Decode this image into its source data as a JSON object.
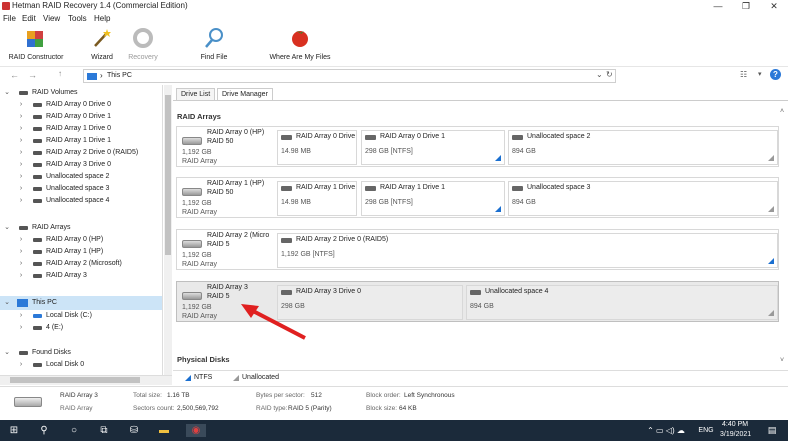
{
  "window": {
    "title": "Hetman RAID Recovery 1.4 (Commercial Edition)",
    "minimize": "—",
    "maximize": "❐",
    "close": "✕"
  },
  "menu": [
    "File",
    "Edit",
    "View",
    "Tools",
    "Help"
  ],
  "ribbon": {
    "raid_constructor": "RAID Constructor",
    "wizard": "Wizard",
    "recovery": "Recovery",
    "find_file": "Find File",
    "where_are_my_files": "Where Are My Files"
  },
  "address": {
    "back": "←",
    "forward": "→",
    "up": "↑",
    "path": "This PC",
    "sep": "›",
    "dropdown": "⌄",
    "refresh": "↻"
  },
  "tree": {
    "raid_volumes": "RAID Volumes",
    "volumes": [
      "RAID Array 0 Drive 0",
      "RAID Array 0 Drive 1",
      "RAID Array 1 Drive 0",
      "RAID Array 1 Drive 1",
      "RAID Array 2 Drive 0 (RAID5)",
      "RAID Array 3 Drive 0",
      "Unallocated space 2",
      "Unallocated space 3",
      "Unallocated space 4"
    ],
    "raid_arrays": "RAID Arrays",
    "arrays": [
      "RAID Array 0 (HP)",
      "RAID Array 1 (HP)",
      "RAID Array 2 (Microsoft)",
      "RAID Array 3"
    ],
    "this_pc": "This PC",
    "pc_items": [
      "Local Disk (C:)",
      "4 (E:)"
    ],
    "found_disks": "Found Disks",
    "found_items": [
      "Local Disk 0"
    ]
  },
  "tabs": {
    "drive_list": "Drive List",
    "drive_manager": "Drive Manager"
  },
  "sections": {
    "raid_arrays": "RAID Arrays",
    "physical_disks": "Physical Disks"
  },
  "rows": [
    {
      "name1": "RAID Array 0 (HP)",
      "name2": "RAID 50",
      "size": "1,192 GB",
      "type": "RAID Array",
      "parts": [
        {
          "name": "RAID Array 0 Drive",
          "sub": "14.98 MB"
        },
        {
          "name": "RAID Array 0 Drive 1",
          "sub": "298 GB [NTFS]"
        },
        {
          "name": "Unallocated space 2",
          "sub": "894 GB"
        }
      ]
    },
    {
      "name1": "RAID Array 1 (HP)",
      "name2": "RAID 50",
      "size": "1,192 GB",
      "type": "RAID Array",
      "parts": [
        {
          "name": "RAID Array 1 Drive",
          "sub": "14.98 MB"
        },
        {
          "name": "RAID Array 1 Drive 1",
          "sub": "298 GB [NTFS]"
        },
        {
          "name": "Unallocated space 3",
          "sub": "894 GB"
        }
      ]
    },
    {
      "name1": "RAID Array 2 (Micro",
      "name2": "RAID 5",
      "size": "1,192 GB",
      "type": "RAID Array",
      "parts": [
        {
          "name": "RAID Array 2 Drive 0 (RAID5)",
          "sub": "1,192 GB [NTFS]"
        }
      ]
    },
    {
      "name1": "RAID Array 3",
      "name2": "RAID 5",
      "size": "1,192 GB",
      "type": "RAID Array",
      "parts": [
        {
          "name": "RAID Array 3 Drive 0",
          "sub": "298 GB"
        },
        {
          "name": "Unallocated space 4",
          "sub": "894 GB"
        }
      ]
    }
  ],
  "legend": {
    "ntfs": "NTFS",
    "unallocated": "Unallocated"
  },
  "info": {
    "name": "RAID Array 3",
    "kind": "RAID Array",
    "total_size_k": "Total size:",
    "total_size_v": "1.16 TB",
    "sectors_k": "Sectors count:",
    "sectors_v": "2,500,569,792",
    "bps_k": "Bytes per sector:",
    "bps_v": "512",
    "raid_type_k": "RAID type:",
    "raid_type_v": "RAID 5 (Parity)",
    "block_order_k": "Block order:",
    "block_order_v": "Left Synchronous",
    "block_size_k": "Block size:",
    "block_size_v": "64 KB"
  },
  "taskbar": {
    "lang": "ENG",
    "time": "4:40 PM",
    "date": "3/19/2021"
  },
  "colors": {
    "accent": "#1a6fd0",
    "selection": "#cce4f7",
    "arrow": "#e02020",
    "taskbar": "#1b2a3a"
  }
}
